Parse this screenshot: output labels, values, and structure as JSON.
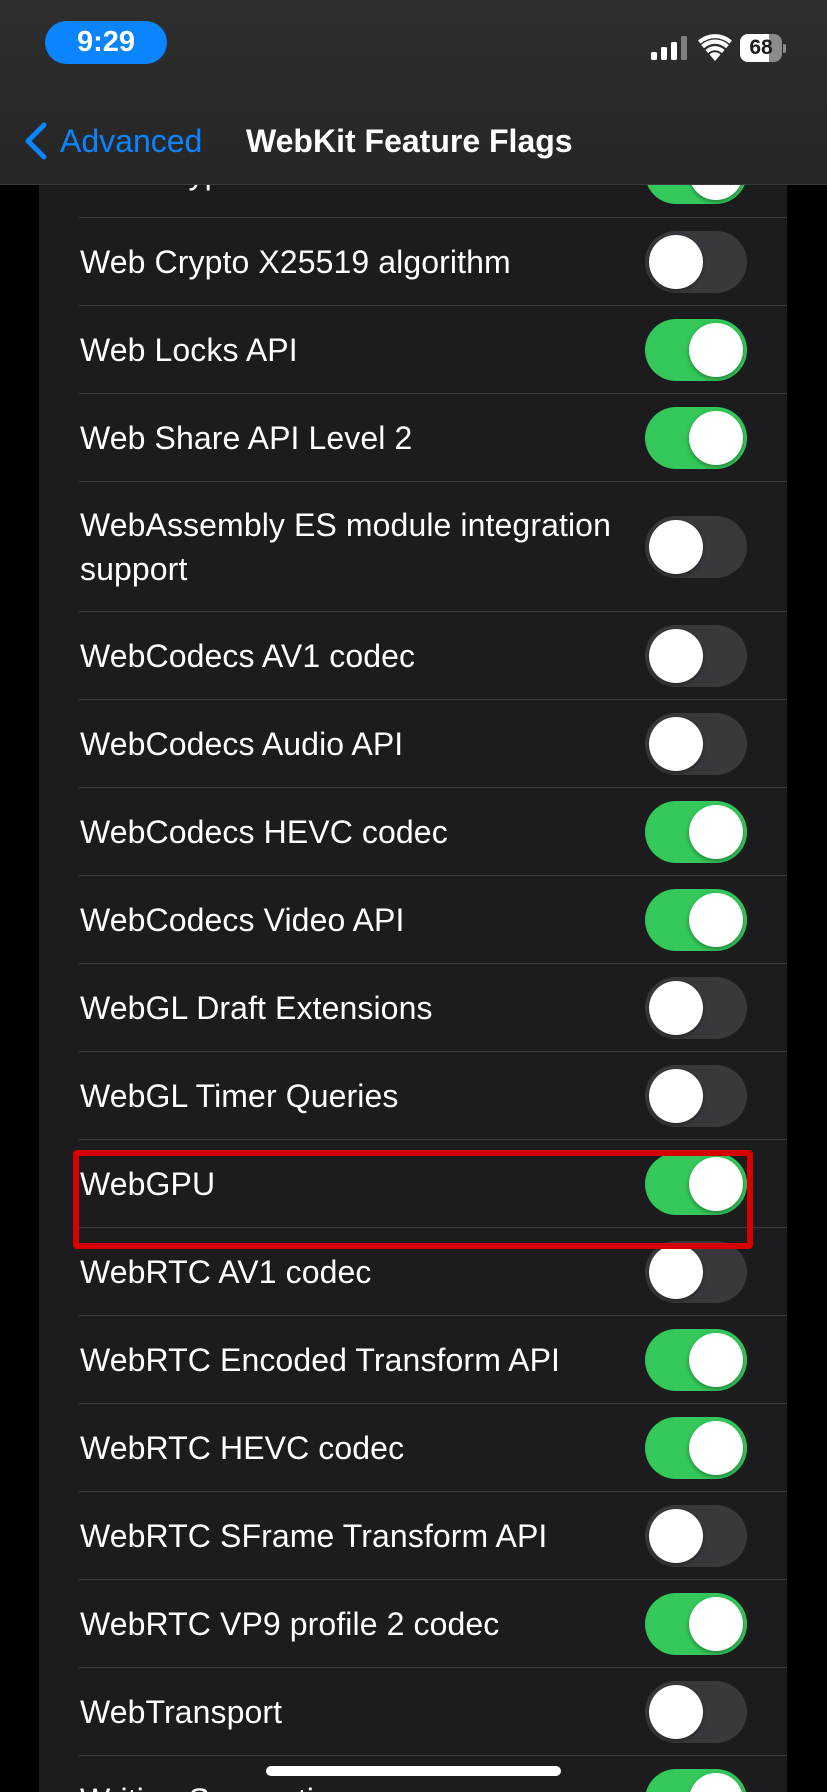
{
  "status_bar": {
    "time": "9:29",
    "battery_level": "68",
    "battery_fraction": 0.68
  },
  "nav": {
    "back_label": "Advanced",
    "title": "WebKit Feature Flags"
  },
  "colors": {
    "toggle_on": "#34c759",
    "toggle_off": "#39393d",
    "accent": "#0a84ff",
    "highlight": "#d50000"
  },
  "flags": [
    {
      "label": "Web Crypto Safe Curves",
      "enabled": true
    },
    {
      "label": "Web Crypto X25519 algorithm",
      "enabled": false
    },
    {
      "label": "Web Locks API",
      "enabled": true
    },
    {
      "label": "Web Share API Level 2",
      "enabled": true
    },
    {
      "label": "WebAssembly ES module integration support",
      "enabled": false
    },
    {
      "label": "WebCodecs AV1 codec",
      "enabled": false
    },
    {
      "label": "WebCodecs Audio API",
      "enabled": false
    },
    {
      "label": "WebCodecs HEVC codec",
      "enabled": true
    },
    {
      "label": "WebCodecs Video API",
      "enabled": true
    },
    {
      "label": "WebGL Draft Extensions",
      "enabled": false
    },
    {
      "label": "WebGL Timer Queries",
      "enabled": false
    },
    {
      "label": "WebGPU",
      "enabled": true,
      "highlighted": true
    },
    {
      "label": "WebRTC AV1 codec",
      "enabled": false
    },
    {
      "label": "WebRTC Encoded Transform API",
      "enabled": true
    },
    {
      "label": "WebRTC HEVC codec",
      "enabled": true
    },
    {
      "label": "WebRTC SFrame Transform API",
      "enabled": false
    },
    {
      "label": "WebRTC VP9 profile 2 codec",
      "enabled": true
    },
    {
      "label": "WebTransport",
      "enabled": false
    },
    {
      "label": "Writing Suggestions",
      "enabled": true
    }
  ]
}
